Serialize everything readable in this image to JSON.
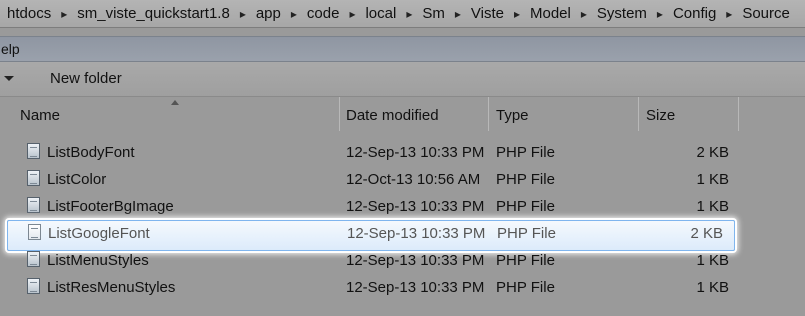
{
  "breadcrumb": [
    "htdocs",
    "sm_viste_quickstart1.8",
    "app",
    "code",
    "local",
    "Sm",
    "Viste",
    "Model",
    "System",
    "Config",
    "Source"
  ],
  "breadcrumb_separator": "▸",
  "menu": {
    "label": "elp"
  },
  "toolbar": {
    "new_folder_label": "New folder"
  },
  "columns": {
    "name": "Name",
    "date_modified": "Date modified",
    "type": "Type",
    "size": "Size"
  },
  "files": [
    {
      "name": "ListBodyFont",
      "date": "12-Sep-13 10:33 PM",
      "type": "PHP File",
      "size": "2 KB",
      "selected": false
    },
    {
      "name": "ListColor",
      "date": "12-Oct-13 10:56 AM",
      "type": "PHP File",
      "size": "1 KB",
      "selected": false
    },
    {
      "name": "ListFooterBgImage",
      "date": "12-Sep-13 10:33 PM",
      "type": "PHP File",
      "size": "1 KB",
      "selected": false
    },
    {
      "name": "ListGoogleFont",
      "date": "12-Sep-13 10:33 PM",
      "type": "PHP File",
      "size": "2 KB",
      "selected": true
    },
    {
      "name": "ListMenuStyles",
      "date": "12-Sep-13 10:33 PM",
      "type": "PHP File",
      "size": "1 KB",
      "selected": false
    },
    {
      "name": "ListResMenuStyles",
      "date": "12-Sep-13 10:33 PM",
      "type": "PHP File",
      "size": "1 KB",
      "selected": false
    }
  ],
  "icons": {
    "file": "php-file-icon",
    "dropdown": "chevron-down-icon",
    "sort": "sort-ascending-icon"
  }
}
